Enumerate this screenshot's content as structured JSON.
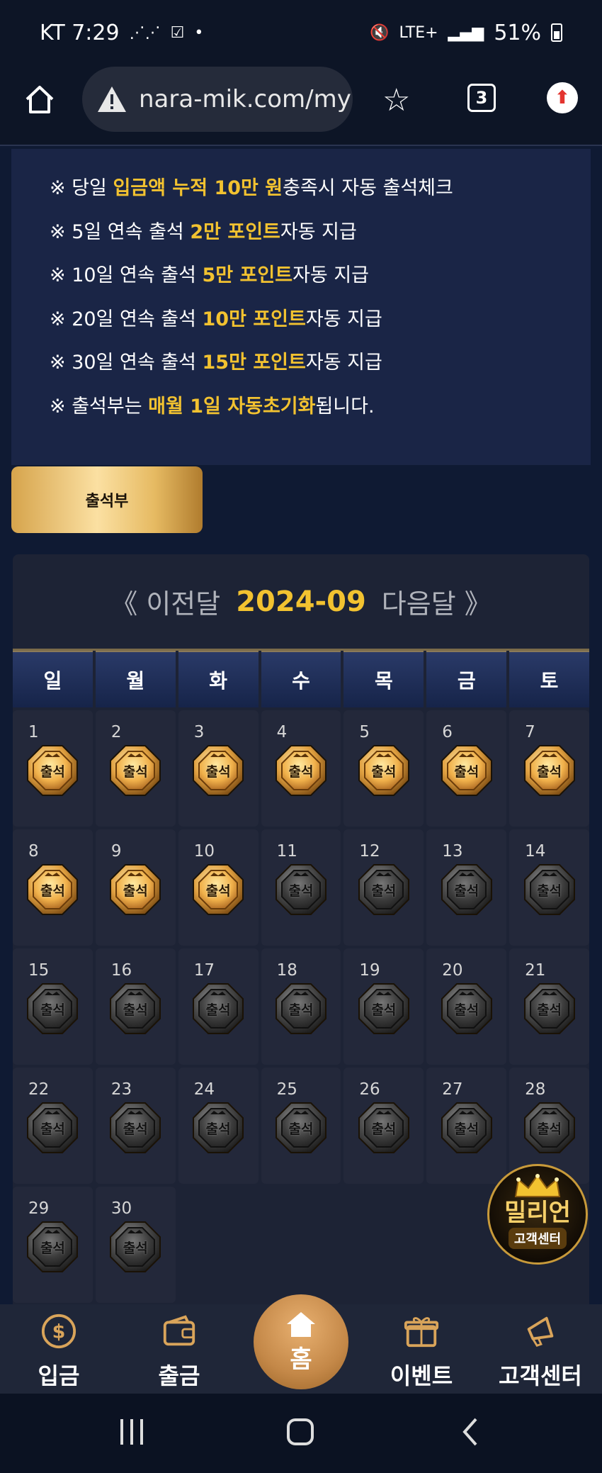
{
  "status_bar": {
    "carrier_time": "KT 7:29",
    "network": "LTE+",
    "battery": "51%"
  },
  "browser": {
    "url": "nara-mik.com/my",
    "tab_count": "3"
  },
  "notice": {
    "lines": [
      {
        "pre": "※ 당일 ",
        "hl": "입금액 누적 10만 원",
        "post": "충족시 자동 출석체크"
      },
      {
        "pre": "※ 5일 연속 출석 ",
        "hl": "2만 포인트",
        "post": "자동 지급"
      },
      {
        "pre": "※ 10일 연속 출석 ",
        "hl": "5만 포인트",
        "post": "자동 지급"
      },
      {
        "pre": "※ 20일 연속 출석 ",
        "hl": "10만 포인트",
        "post": "자동 지급"
      },
      {
        "pre": "※ 30일 연속 출석 ",
        "hl": "15만 포인트",
        "post": "자동 지급"
      },
      {
        "pre": "※ 출석부는 ",
        "hl": "매월 1일 자동초기화",
        "post": "됩니다."
      }
    ]
  },
  "attendance_button": "출석부",
  "calendar": {
    "prev_label": "《 이전달",
    "month": "2024-09",
    "next_label": "다음달 》",
    "weekdays": [
      "일",
      "월",
      "화",
      "수",
      "목",
      "금",
      "토"
    ],
    "badge_label": "출석",
    "days": [
      {
        "n": "1",
        "on": true
      },
      {
        "n": "2",
        "on": true
      },
      {
        "n": "3",
        "on": true
      },
      {
        "n": "4",
        "on": true
      },
      {
        "n": "5",
        "on": true
      },
      {
        "n": "6",
        "on": true
      },
      {
        "n": "7",
        "on": true
      },
      {
        "n": "8",
        "on": true
      },
      {
        "n": "9",
        "on": true
      },
      {
        "n": "10",
        "on": true
      },
      {
        "n": "11",
        "on": false
      },
      {
        "n": "12",
        "on": false
      },
      {
        "n": "13",
        "on": false
      },
      {
        "n": "14",
        "on": false
      },
      {
        "n": "15",
        "on": false
      },
      {
        "n": "16",
        "on": false
      },
      {
        "n": "17",
        "on": false
      },
      {
        "n": "18",
        "on": false
      },
      {
        "n": "19",
        "on": false
      },
      {
        "n": "20",
        "on": false
      },
      {
        "n": "21",
        "on": false
      },
      {
        "n": "22",
        "on": false
      },
      {
        "n": "23",
        "on": false
      },
      {
        "n": "24",
        "on": false
      },
      {
        "n": "25",
        "on": false
      },
      {
        "n": "26",
        "on": false
      },
      {
        "n": "27",
        "on": false
      },
      {
        "n": "28",
        "on": false
      },
      {
        "n": "29",
        "on": false
      },
      {
        "n": "30",
        "on": false
      }
    ]
  },
  "vip_badge": {
    "title": "밀리언",
    "subtitle": "고객센터"
  },
  "bottom_nav": {
    "deposit": "입금",
    "withdraw": "출금",
    "home": "홈",
    "event": "이벤트",
    "support": "고객센터"
  },
  "colors": {
    "highlight": "#f2c230",
    "gold": "#d6a44c",
    "panel": "#1a2546"
  }
}
